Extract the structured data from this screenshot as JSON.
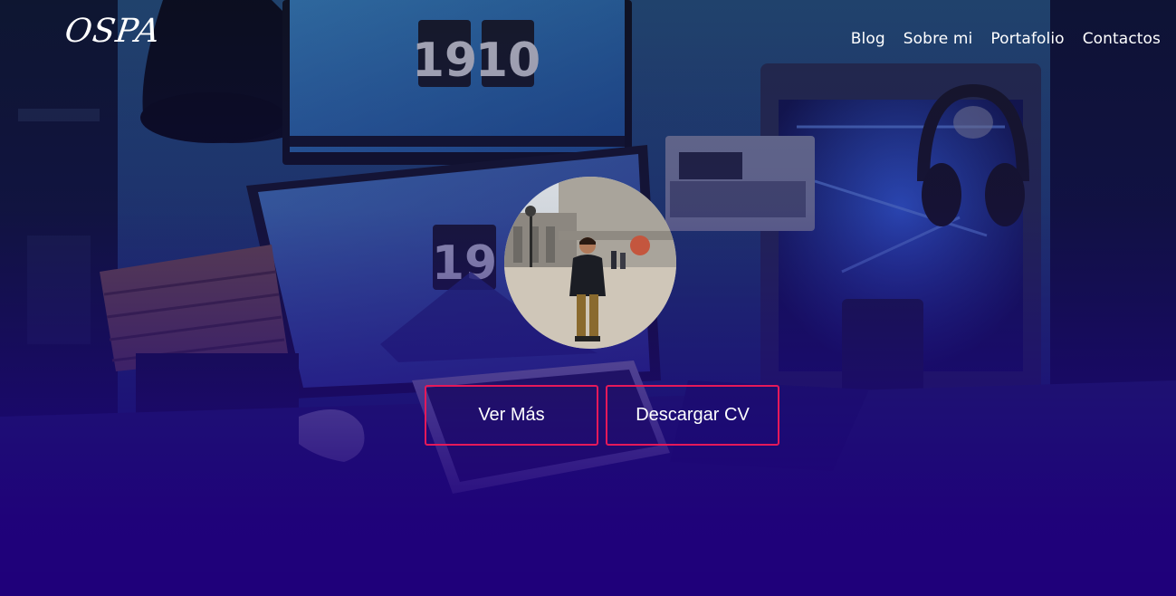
{
  "header": {
    "logo": "OSPA",
    "nav": [
      "Blog",
      "Sobre mi",
      "Portafolio",
      "Contactos"
    ]
  },
  "background": {
    "monitor_clock_top": [
      "19",
      "10"
    ],
    "monitor_clock_bottom": "19"
  },
  "hero": {
    "buttons": {
      "primary_label": "Ver Más",
      "secondary_label": "Descargar CV"
    }
  },
  "colors": {
    "accent": "#e5195a",
    "gradient_bottom": "#1f007a",
    "text": "#ffffff"
  }
}
